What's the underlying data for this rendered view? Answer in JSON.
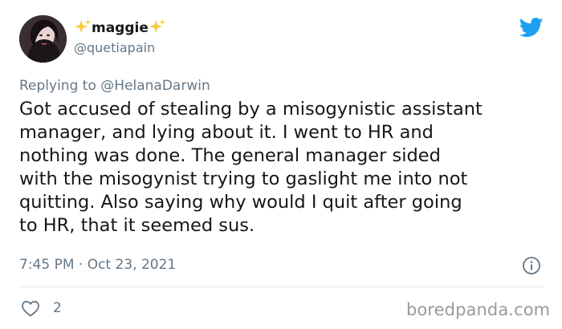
{
  "author": {
    "display_name": "maggie",
    "handle": "@quetiapain",
    "avatar": "avatar-photo",
    "name_decoration_icon": "sparkles-icon"
  },
  "brand": {
    "icon": "twitter-bird-icon",
    "color": "#1da1f2"
  },
  "reply": {
    "prefix": "Replying to",
    "mention": "@HelanaDarwin"
  },
  "tweet": {
    "lines": [
      "Got accused of stealing by a misogynistic assistant",
      "manager, and lying about it. I went to HR and",
      "nothing was done. The general manager sided",
      "with the misogynist trying to gaslight me into not",
      "quitting. Also saying why would I quit after going",
      "to HR, that it seemed sus."
    ],
    "timestamp": "7:45 PM · Oct 23, 2021"
  },
  "actions": {
    "like_icon": "heart-icon",
    "like_count": "2",
    "info_icon": "info-icon"
  },
  "watermark": "boredpanda.com",
  "colors": {
    "text_primary": "#14171a",
    "text_secondary": "#657786",
    "divider": "#e1e8ed",
    "sparkle": "#f9c93b",
    "watermark": "#9a9a9a"
  }
}
